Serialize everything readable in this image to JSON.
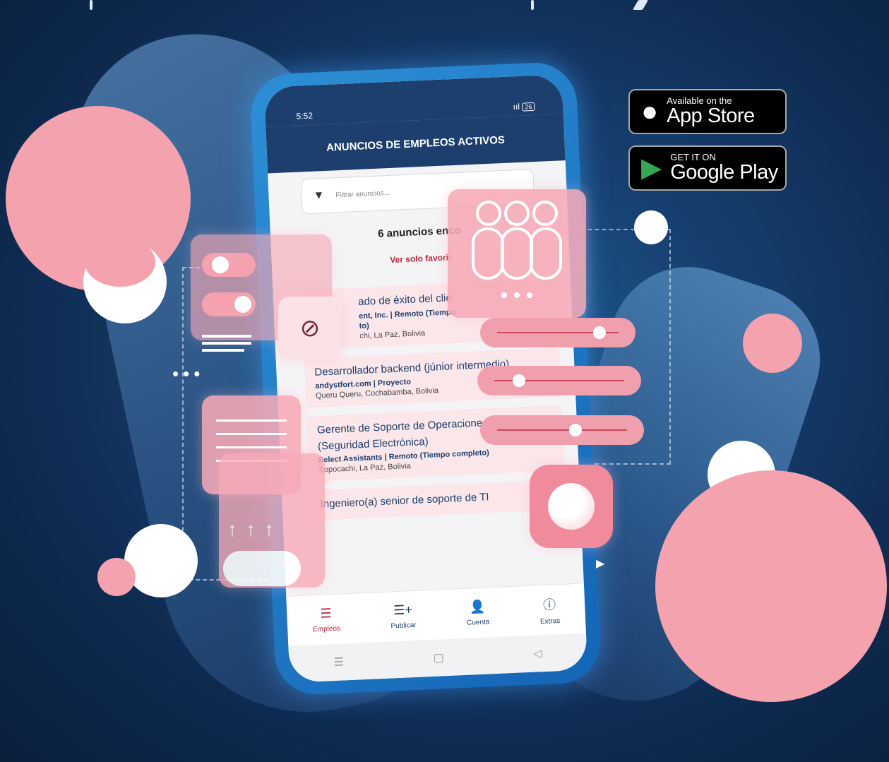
{
  "status_bar": {
    "time": "5:52",
    "signal": "ııl",
    "battery": "26"
  },
  "app": {
    "header_title": "ANUNCIOS DE EMPLEOS ACTIVOS",
    "filter_placeholder": "Filtrar anuncios...",
    "results_count": "6 anuncios enco",
    "favorites_link": "Ver solo favorit",
    "jobs": [
      {
        "title": "ado de éxito del clie",
        "company": "ent, Inc. | Remoto (Tiempo",
        "company2": "to)",
        "location": "chi, La Paz, Bolivia"
      },
      {
        "title": "Desarrollador backend (júnior intermedio)",
        "company": "andystfort.com | Proyecto",
        "location": "Queru Queru, Cochabamba, Bolivia"
      },
      {
        "title": "Gerente de Soporte de Operaciones (Seguridad Electrónica)",
        "company": "Select Assistants | Remoto (Tiempo completo)",
        "location": "Sopocachi, La Paz, Bolivia"
      },
      {
        "title": "Ingeniero(a) senior de soporte de TI",
        "company": "",
        "location": ""
      }
    ],
    "tabs": [
      {
        "label": "Empleos",
        "icon": "list-icon"
      },
      {
        "label": "Publicar",
        "icon": "add-list-icon"
      },
      {
        "label": "Cuenta",
        "icon": "user-gear-icon"
      },
      {
        "label": "Extras",
        "icon": "info-icon"
      }
    ]
  },
  "badges": {
    "app_store": {
      "small": "Available on the",
      "big": "App Store"
    },
    "google_play": {
      "small": "GET IT ON",
      "big": "Google Play"
    }
  },
  "colors": {
    "background": "#163f6e",
    "header": "#1c3f6e",
    "pink": "#f4a2ad",
    "accent_red": "#c0243a"
  }
}
